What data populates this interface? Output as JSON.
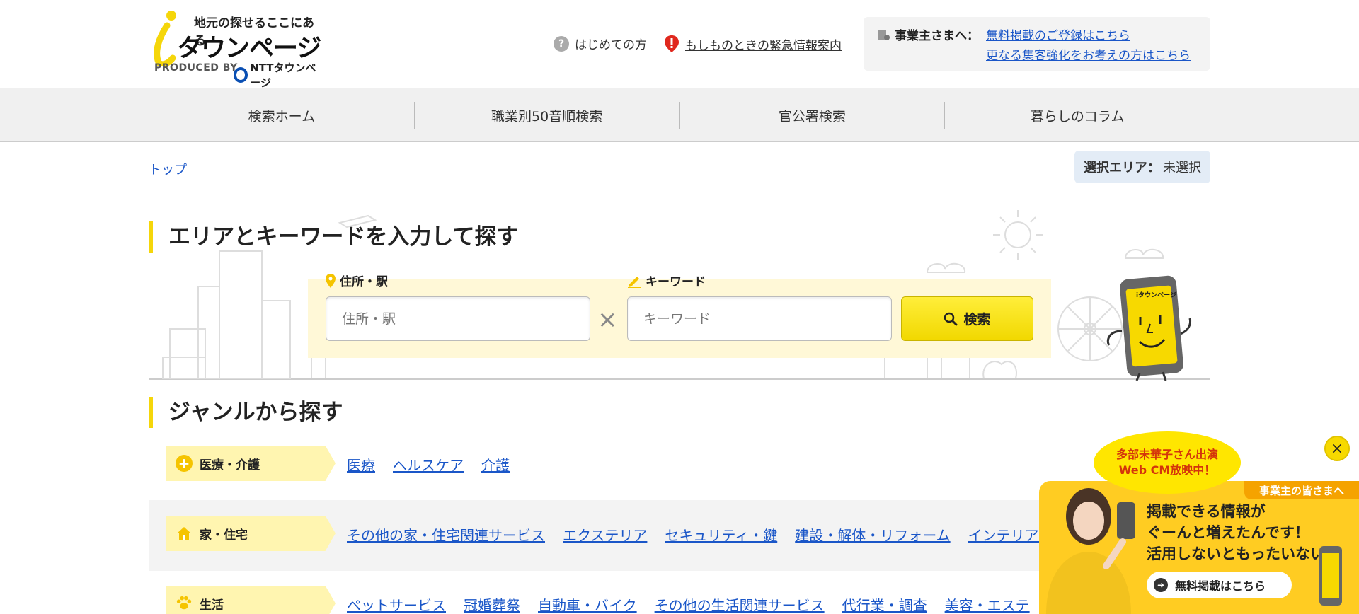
{
  "header": {
    "logo_tagline": "地元の探せるここにある",
    "logo_name": "タウンページ",
    "logo_produced_by": "PRODUCED BY",
    "logo_ntt": "NTTタウンページ",
    "link_first_time": "はじめての方",
    "link_emergency": "もしものときの緊急情報案内",
    "biz_label": "事業主さまへ：",
    "biz_link_register": "無料掲載のご登録はこちら",
    "biz_link_attract": "更なる集客強化をお考えの方はこちら"
  },
  "nav": {
    "items": [
      "検索ホーム",
      "職業別50音順検索",
      "官公署検索",
      "暮らしのコラム"
    ]
  },
  "breadcrumb": {
    "top": "トップ"
  },
  "area": {
    "label": "選択エリア：",
    "value": "未選択"
  },
  "search": {
    "title": "エリアとキーワードを入力して探す",
    "address_label": "住所・駅",
    "address_placeholder": "住所・駅",
    "keyword_label": "キーワード",
    "keyword_placeholder": "キーワード",
    "times_symbol": "×",
    "button_label": "検索",
    "mascot_screen_text": "iタウンページ"
  },
  "genres": {
    "title": "ジャンルから探す",
    "rows": [
      {
        "label": "医療・介護",
        "icon": "plus-icon",
        "links": [
          "医療",
          "ヘルスケア",
          "介護"
        ]
      },
      {
        "label": "家・住宅",
        "icon": "house-icon",
        "links": [
          "その他の家・住宅関連サービス",
          "エクステリア",
          "セキュリティ・鍵",
          "建設・解体・リフォーム",
          "インテリア・家"
        ]
      },
      {
        "label": "生活",
        "icon": "paw-icon",
        "links": [
          "ペットサービス",
          "冠婚葬祭",
          "自動車・バイク",
          "その他の生活関連サービス",
          "代行業・調査",
          "美容・エステ"
        ]
      }
    ]
  },
  "promo": {
    "bubble_line1": "多部未華子さん出演",
    "bubble_line2": "Web CM放映中！",
    "header": "事業主の皆さまへ",
    "text_line1": "掲載できる情報が",
    "text_line2": "ぐーんと増えたんです！",
    "text_line3": "活用しないともったいない！",
    "button": "無料掲載はこちら",
    "close_symbol": "×"
  },
  "colors": {
    "accent_yellow": "#f5d60a",
    "link_blue": "#1a56c8",
    "area_badge_bg": "#e3ecf6",
    "promo_yellow": "#ffcc22"
  }
}
